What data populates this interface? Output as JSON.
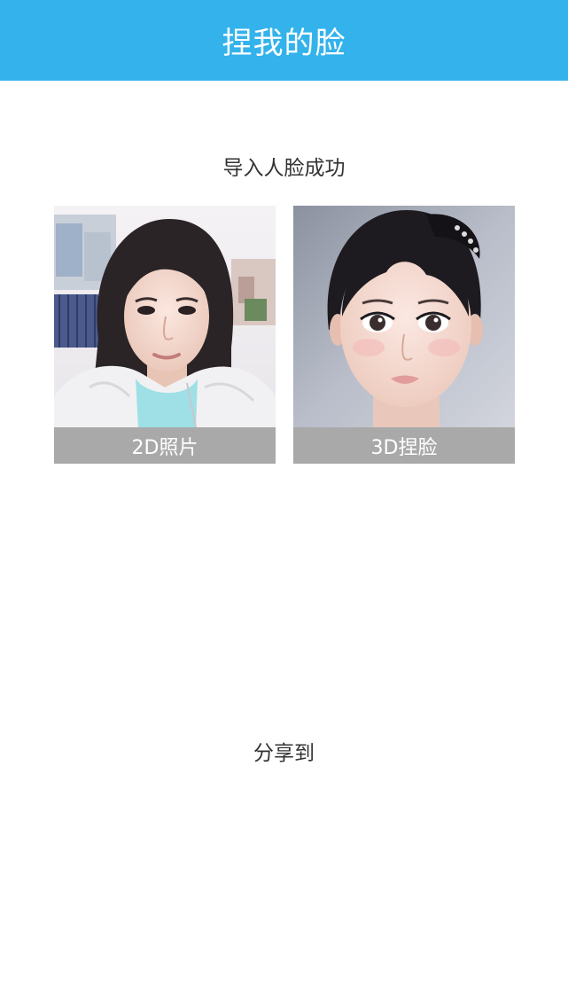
{
  "header": {
    "title": "捏我的脸",
    "background_color": "#33b2ec"
  },
  "main": {
    "status": "导入人脸成功",
    "cards": [
      {
        "caption": "2D照片",
        "image": "selfie-photo"
      },
      {
        "caption": "3D捏脸",
        "image": "3d-face-render"
      }
    ]
  },
  "share": {
    "label": "分享到"
  }
}
